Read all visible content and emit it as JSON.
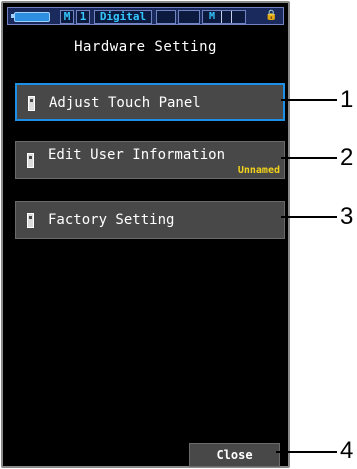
{
  "statusbar": {
    "mode_letter": "M",
    "mode_number": "1",
    "camera_type": "Digital",
    "indicator": "M",
    "lock_icon": "lock-icon"
  },
  "title": "Hardware Setting",
  "menu": {
    "items": [
      {
        "label": "Adjust Touch Panel",
        "sub": "",
        "selected": true
      },
      {
        "label": "Edit User Information",
        "sub": "Unnamed",
        "selected": false
      },
      {
        "label": "Factory Setting",
        "sub": "",
        "selected": false
      }
    ]
  },
  "close_label": "Close",
  "callouts": [
    "1",
    "2",
    "3",
    "4"
  ],
  "colors": {
    "screen_bg": "#000000",
    "button_bg": "#484848",
    "selected_border": "#1e8fe6",
    "sub_text": "#f2d21a",
    "status_text": "#35c7ff"
  }
}
